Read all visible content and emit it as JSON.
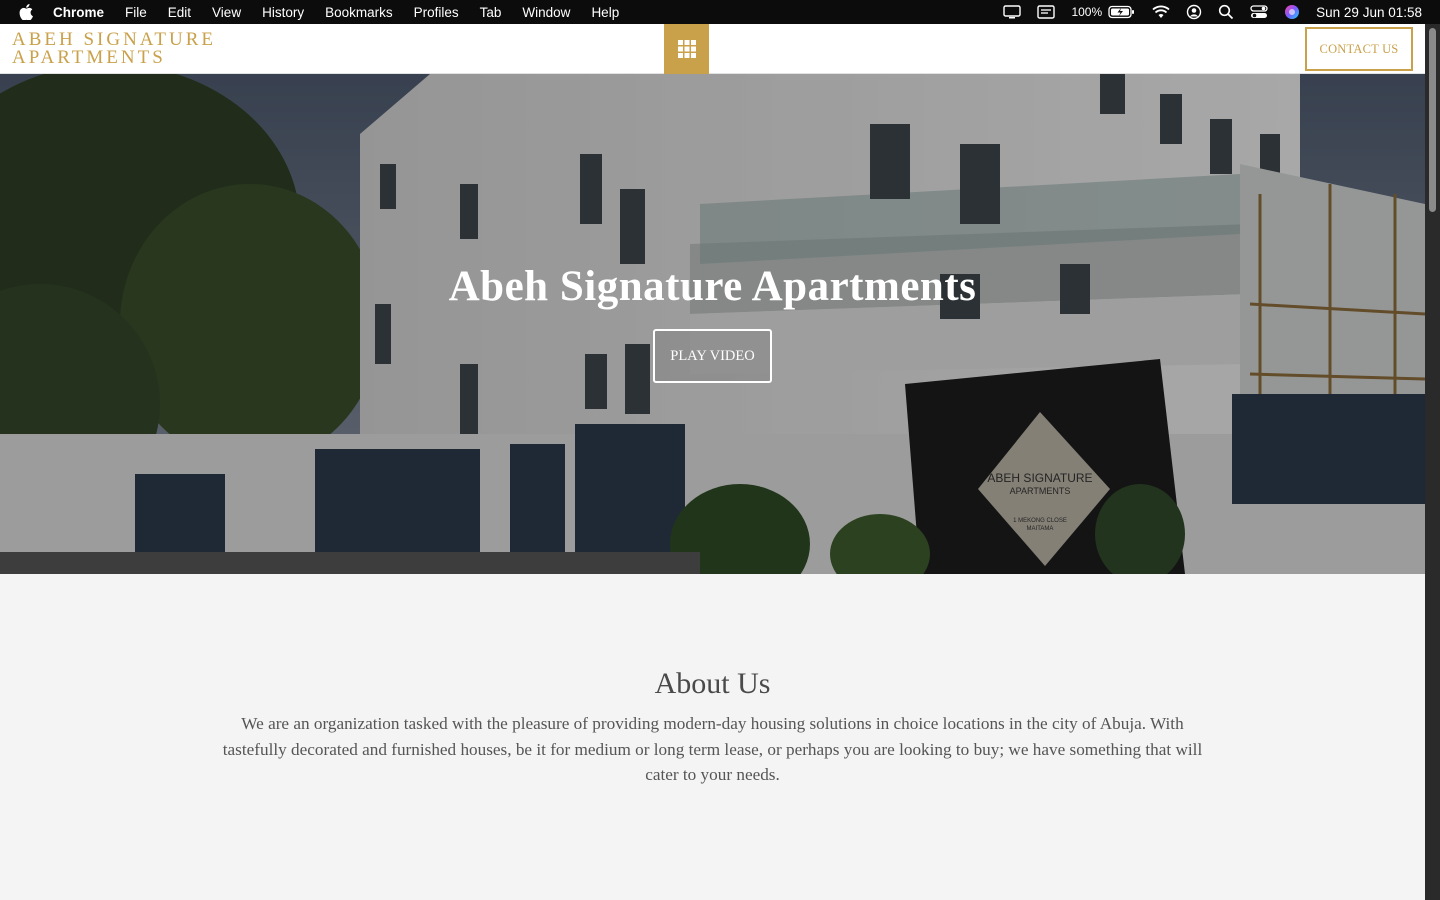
{
  "menubar": {
    "app": "Chrome",
    "items": [
      "File",
      "Edit",
      "View",
      "History",
      "Bookmarks",
      "Profiles",
      "Tab",
      "Window",
      "Help"
    ],
    "battery": "100%",
    "clock": "Sun 29 Jun  01:58"
  },
  "site": {
    "logo_line1": "ABEH SIGNATURE",
    "logo_line2": "APARTMENTS",
    "contact_label": "CONTACT US",
    "accent": "#c9a14a"
  },
  "hero": {
    "title": "Abeh Signature Apartments",
    "play_label": "PLAY VIDEO",
    "sign_line1": "ABEH SIGNATURE",
    "sign_line2": "APARTMENTS",
    "sign_line3": "1 MEKONG CLOSE",
    "sign_line4": "MAITAMA"
  },
  "about": {
    "heading": "About Us",
    "body": "We are an organization tasked with the pleasure of providing modern-day housing solutions in choice locations in the city of Abuja. With tastefully decorated and furnished houses, be it for medium or long term lease, or perhaps you are looking to buy; we have something that will cater to your needs."
  }
}
